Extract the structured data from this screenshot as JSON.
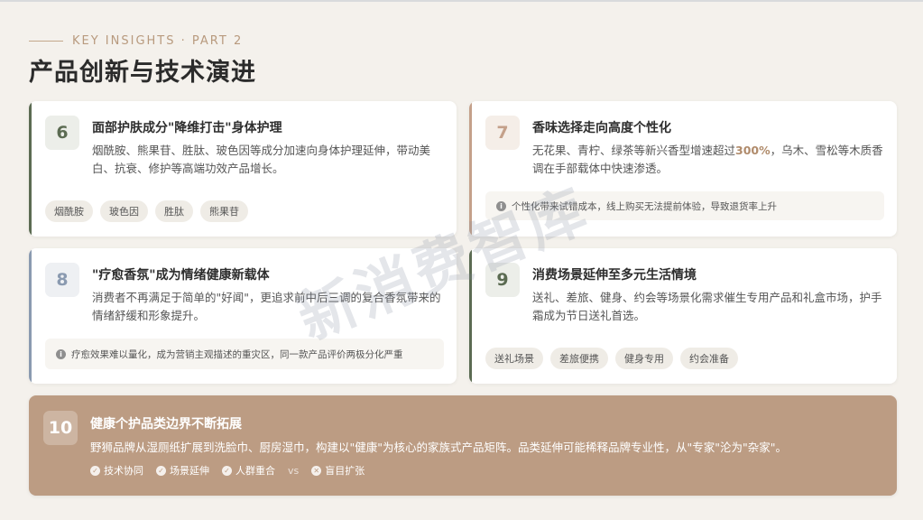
{
  "header": {
    "kicker": "KEY INSIGHTS · PART 2",
    "title": "产品创新与技术演进"
  },
  "colors": {
    "dark_green": "#5b6b52",
    "tan": "#c4a08a",
    "blue_gray": "#8a9ab0",
    "wide_card": "#bc9c83"
  },
  "cards": [
    {
      "num": "6",
      "title": "面部护肤成分\"降维打击\"身体护理",
      "desc": "烟酰胺、熊果苷、胜肽、玻色因等成分加速向身体护理延伸，带动美白、抗衰、修护等高端功效产品增长。",
      "tags": [
        "烟酰胺",
        "玻色因",
        "胜肽",
        "熊果苷"
      ]
    },
    {
      "num": "7",
      "title": "香味选择走向高度个性化",
      "desc_pre": "无花果、青柠、绿茶等新兴香型增速超过",
      "desc_hl": "300%",
      "desc_post": "，乌木、雪松等木质香调在手部载体中快速渗透。",
      "note": "个性化带来试错成本，线上购买无法提前体验，导致退货率上升"
    },
    {
      "num": "8",
      "title": "\"疗愈香氛\"成为情绪健康新载体",
      "desc": "消费者不再满足于简单的\"好闻\"，更追求前中后三调的复合香氛带来的情绪舒缓和形象提升。",
      "note": "疗愈效果难以量化，成为营销主观描述的重灾区，同一款产品评价两极分化严重"
    },
    {
      "num": "9",
      "title": "消费场景延伸至多元生活情境",
      "desc": "送礼、差旅、健身、约会等场景化需求催生专用产品和礼盒市场，护手霜成为节日送礼首选。",
      "tags": [
        "送礼场景",
        "差旅便携",
        "健身专用",
        "约会准备"
      ]
    }
  ],
  "wide": {
    "num": "10",
    "title": "健康个护品类边界不断拓展",
    "desc": "野狮品牌从湿厕纸扩展到洗脸巾、厨房湿巾，构建以\"健康\"为核心的家族式产品矩阵。品类延伸可能稀释品牌专业性，从\"专家\"沦为\"杂家\"。",
    "points": [
      "技术协同",
      "场景延伸",
      "人群重合"
    ],
    "vs": "vs",
    "negative": "盲目扩张"
  },
  "watermark": "新消费智库"
}
